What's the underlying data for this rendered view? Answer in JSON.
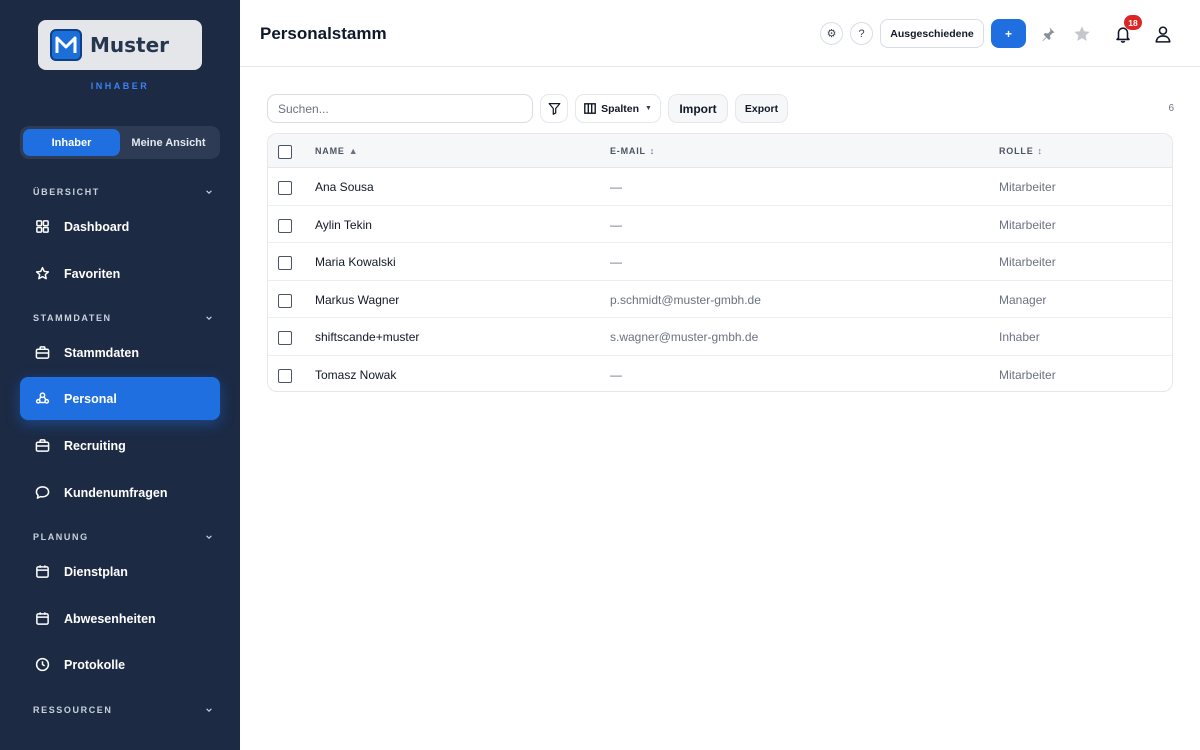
{
  "app": {
    "logo_text": "Muster",
    "role_label": "INHABER"
  },
  "view_toggle": {
    "options": [
      "Inhaber",
      "Meine Ansicht"
    ],
    "selected": "Inhaber"
  },
  "sidebar": {
    "sections": [
      {
        "label": "ÜBERSICHT",
        "items": [
          {
            "label": "Dashboard",
            "icon": "grid-icon"
          },
          {
            "label": "Favoriten",
            "icon": "star-icon"
          }
        ]
      },
      {
        "label": "STAMMDATEN",
        "items": [
          {
            "label": "Stammdaten",
            "icon": "briefcase-icon"
          },
          {
            "label": "Personal",
            "icon": "users-icon",
            "active": true
          },
          {
            "label": "Recruiting",
            "icon": "briefcase-icon"
          },
          {
            "label": "Kundenumfragen",
            "icon": "chat-bubble-icon"
          }
        ]
      },
      {
        "label": "PLANUNG",
        "items": [
          {
            "label": "Dienstplan",
            "icon": "calendar-icon"
          },
          {
            "label": "Abwesenheiten",
            "icon": "calendar-icon"
          },
          {
            "label": "Protokolle",
            "icon": "clock-icon"
          }
        ]
      },
      {
        "label": "RESSOURCEN",
        "items": []
      }
    ]
  },
  "header": {
    "title": "Personalstamm",
    "settings_glyph": "⚙",
    "help_glyph": "?",
    "ausgeschiedene_label": "Ausgeschiedene",
    "add_label": "+",
    "notification_count": "18"
  },
  "toolbar": {
    "search_placeholder": "Suchen...",
    "columns_label": "Spalten",
    "import_label": "Import",
    "export_label": "Export",
    "result_count": "6"
  },
  "table": {
    "columns": [
      {
        "label": "NAME",
        "sort": "▲"
      },
      {
        "label": "E-MAIL",
        "sort": "↕"
      },
      {
        "label": "ROLLE",
        "sort": "↕"
      }
    ],
    "rows": [
      {
        "name": "Ana Sousa",
        "email": "—",
        "role": "Mitarbeiter"
      },
      {
        "name": "Aylin Tekin",
        "email": "—",
        "role": "Mitarbeiter"
      },
      {
        "name": "Maria Kowalski",
        "email": "—",
        "role": "Mitarbeiter"
      },
      {
        "name": "Markus Wagner",
        "email": "p.schmidt@muster-gmbh.de",
        "role": "Manager"
      },
      {
        "name": "shiftscande+muster",
        "email": "s.wagner@muster-gmbh.de",
        "role": "Inhaber"
      },
      {
        "name": "Tomasz Nowak",
        "email": "—",
        "role": "Mitarbeiter"
      }
    ]
  },
  "colors": {
    "sidebar_bg": "#1c2a44",
    "accent": "#1f6fe0",
    "badge": "#dc2626"
  }
}
